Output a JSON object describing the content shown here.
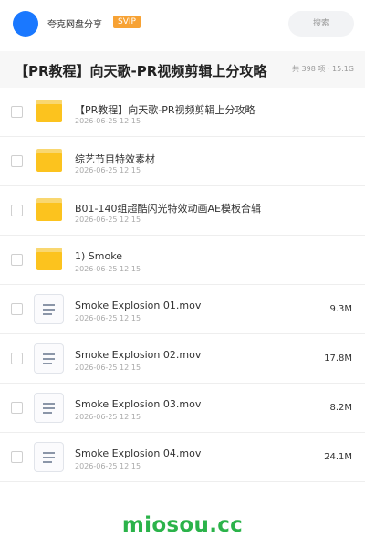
{
  "header": {
    "user_name": "夸克网盘分享",
    "badge": "SVIP",
    "search_label": "搜索"
  },
  "title_bar": {
    "title": "【PR教程】向天歌-PR视频剪辑上分攻略",
    "stats": "共 398 项 · 15.1G"
  },
  "items": [
    {
      "type": "folder",
      "icon": "folder-icon",
      "name": "【PR教程】向天歌-PR视频剪辑上分攻略",
      "date": "2026-06-25 12:15",
      "size": ""
    },
    {
      "type": "folder",
      "icon": "folder-icon",
      "name": "综艺节目特效素材",
      "date": "2026-06-25 12:15",
      "size": ""
    },
    {
      "type": "folder",
      "icon": "folder-icon",
      "name": "B01-140组超酷闪光特效动画AE模板合辑",
      "date": "2026-06-25 12:15",
      "size": ""
    },
    {
      "type": "folder",
      "icon": "folder-icon",
      "name": "1) Smoke",
      "date": "2026-06-25 12:15",
      "size": ""
    },
    {
      "type": "file",
      "icon": "document-icon",
      "name": "Smoke Explosion 01.mov",
      "date": "2026-06-25 12:15",
      "size": "9.3M"
    },
    {
      "type": "file",
      "icon": "document-icon",
      "name": "Smoke Explosion 02.mov",
      "date": "2026-06-25 12:15",
      "size": "17.8M"
    },
    {
      "type": "file",
      "icon": "document-icon",
      "name": "Smoke Explosion 03.mov",
      "date": "2026-06-25 12:15",
      "size": "8.2M"
    },
    {
      "type": "file",
      "icon": "document-icon",
      "name": "Smoke Explosion 04.mov",
      "date": "2026-06-25 12:15",
      "size": "24.1M"
    }
  ],
  "watermark": "miosou.cc",
  "colors": {
    "accent": "#1a78ff",
    "svip": "#f7a234",
    "folder": "#fcc31e",
    "watermark": "#2bb34a"
  }
}
